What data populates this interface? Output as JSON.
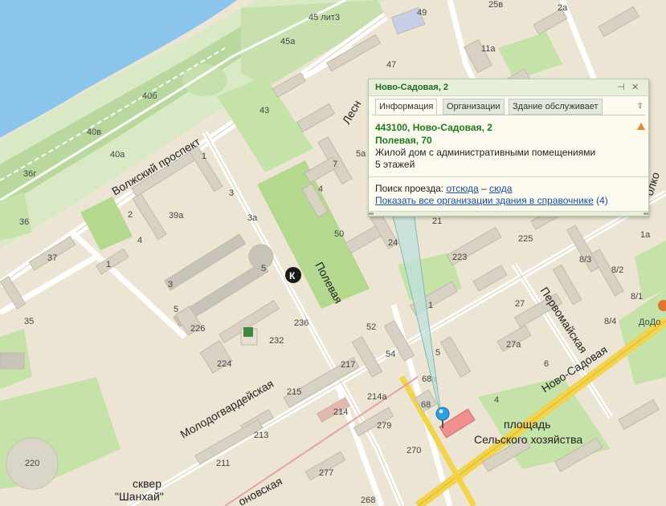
{
  "popup": {
    "title": "Ново-Садовая, 2",
    "tabs": [
      "Информация",
      "Организации",
      "Здание обслуживает"
    ],
    "address_line1": "443100, Ново-Садовая, 2",
    "address_line2": "Полевая, 70",
    "description": "Жилой дом с административными помещениями",
    "floors": "5 этажей",
    "route_label": "Поиск проезда:",
    "route_from": "отсюда",
    "route_dash": "–",
    "route_to": "сюда",
    "orgs_link": "Показать все организации здания в справочнике",
    "orgs_count": "(4)",
    "pin_icon": "pin-icon",
    "close_icon": "close-icon",
    "warning_icon": "warning-icon"
  },
  "streets": {
    "volzhsky": "Волжский проспект",
    "polevaya": "Полевая",
    "molodogvardeyskaya": "Молодогвардейская",
    "pervomayskaya": "Первомайская",
    "novo_sadovaya": "Ново-Садовая",
    "les_partial": "Лесн",
    "onovskaya_partial": "оновская",
    "right_partial": "олко"
  },
  "places": {
    "square_l1": "площадь",
    "square_l2": "Сельского хозяйства",
    "skver_l1": "сквер",
    "skver_l2": "\"Шанхай\"",
    "dodo": "ДоДо"
  },
  "house_numbers": {
    "n45lit3": "45 лит3",
    "n49": "49",
    "n25v": "25в",
    "n2a": "2а",
    "n45a": "45а",
    "n11a": "11а",
    "n47": "47",
    "n40b": "40б",
    "n43": "43",
    "n40v": "40в",
    "n40a": "40а",
    "n36g": "36г",
    "n36": "36",
    "n1": "1",
    "n3": "3",
    "n39a": "39а",
    "n2": "2",
    "n3a": "3а",
    "n4": "4",
    "n37": "37",
    "n1b": "1",
    "n5": "5",
    "n3b": "3",
    "n5b": "5",
    "n35": "35",
    "n226": "226",
    "n236": "236",
    "n232": "232",
    "n224": "224",
    "n7": "7",
    "n5a": "5а",
    "n4b": "4",
    "n50": "50",
    "n24": "24",
    "n21": "21",
    "n225": "225",
    "n223": "223",
    "n1r": "1",
    "n1a": "1а",
    "n8_3": "8/3",
    "n8_2": "8/2",
    "n8_1": "8/1",
    "n8_4": "8/4",
    "n27": "27",
    "n27a": "27а",
    "n52": "52",
    "n54": "54",
    "n5c": "5",
    "n68a": "68а",
    "n6": "6",
    "n68": "68",
    "n4c": "4",
    "n217": "217",
    "n215": "215",
    "n214a": "214а",
    "n214": "214",
    "n213": "213",
    "n279": "279",
    "n270": "270",
    "n211": "211",
    "n277": "277",
    "n268": "268",
    "n220": "220",
    "n4l": "4"
  },
  "markers": {
    "metro_letter": "К",
    "target_pin": "map-pin-icon"
  }
}
